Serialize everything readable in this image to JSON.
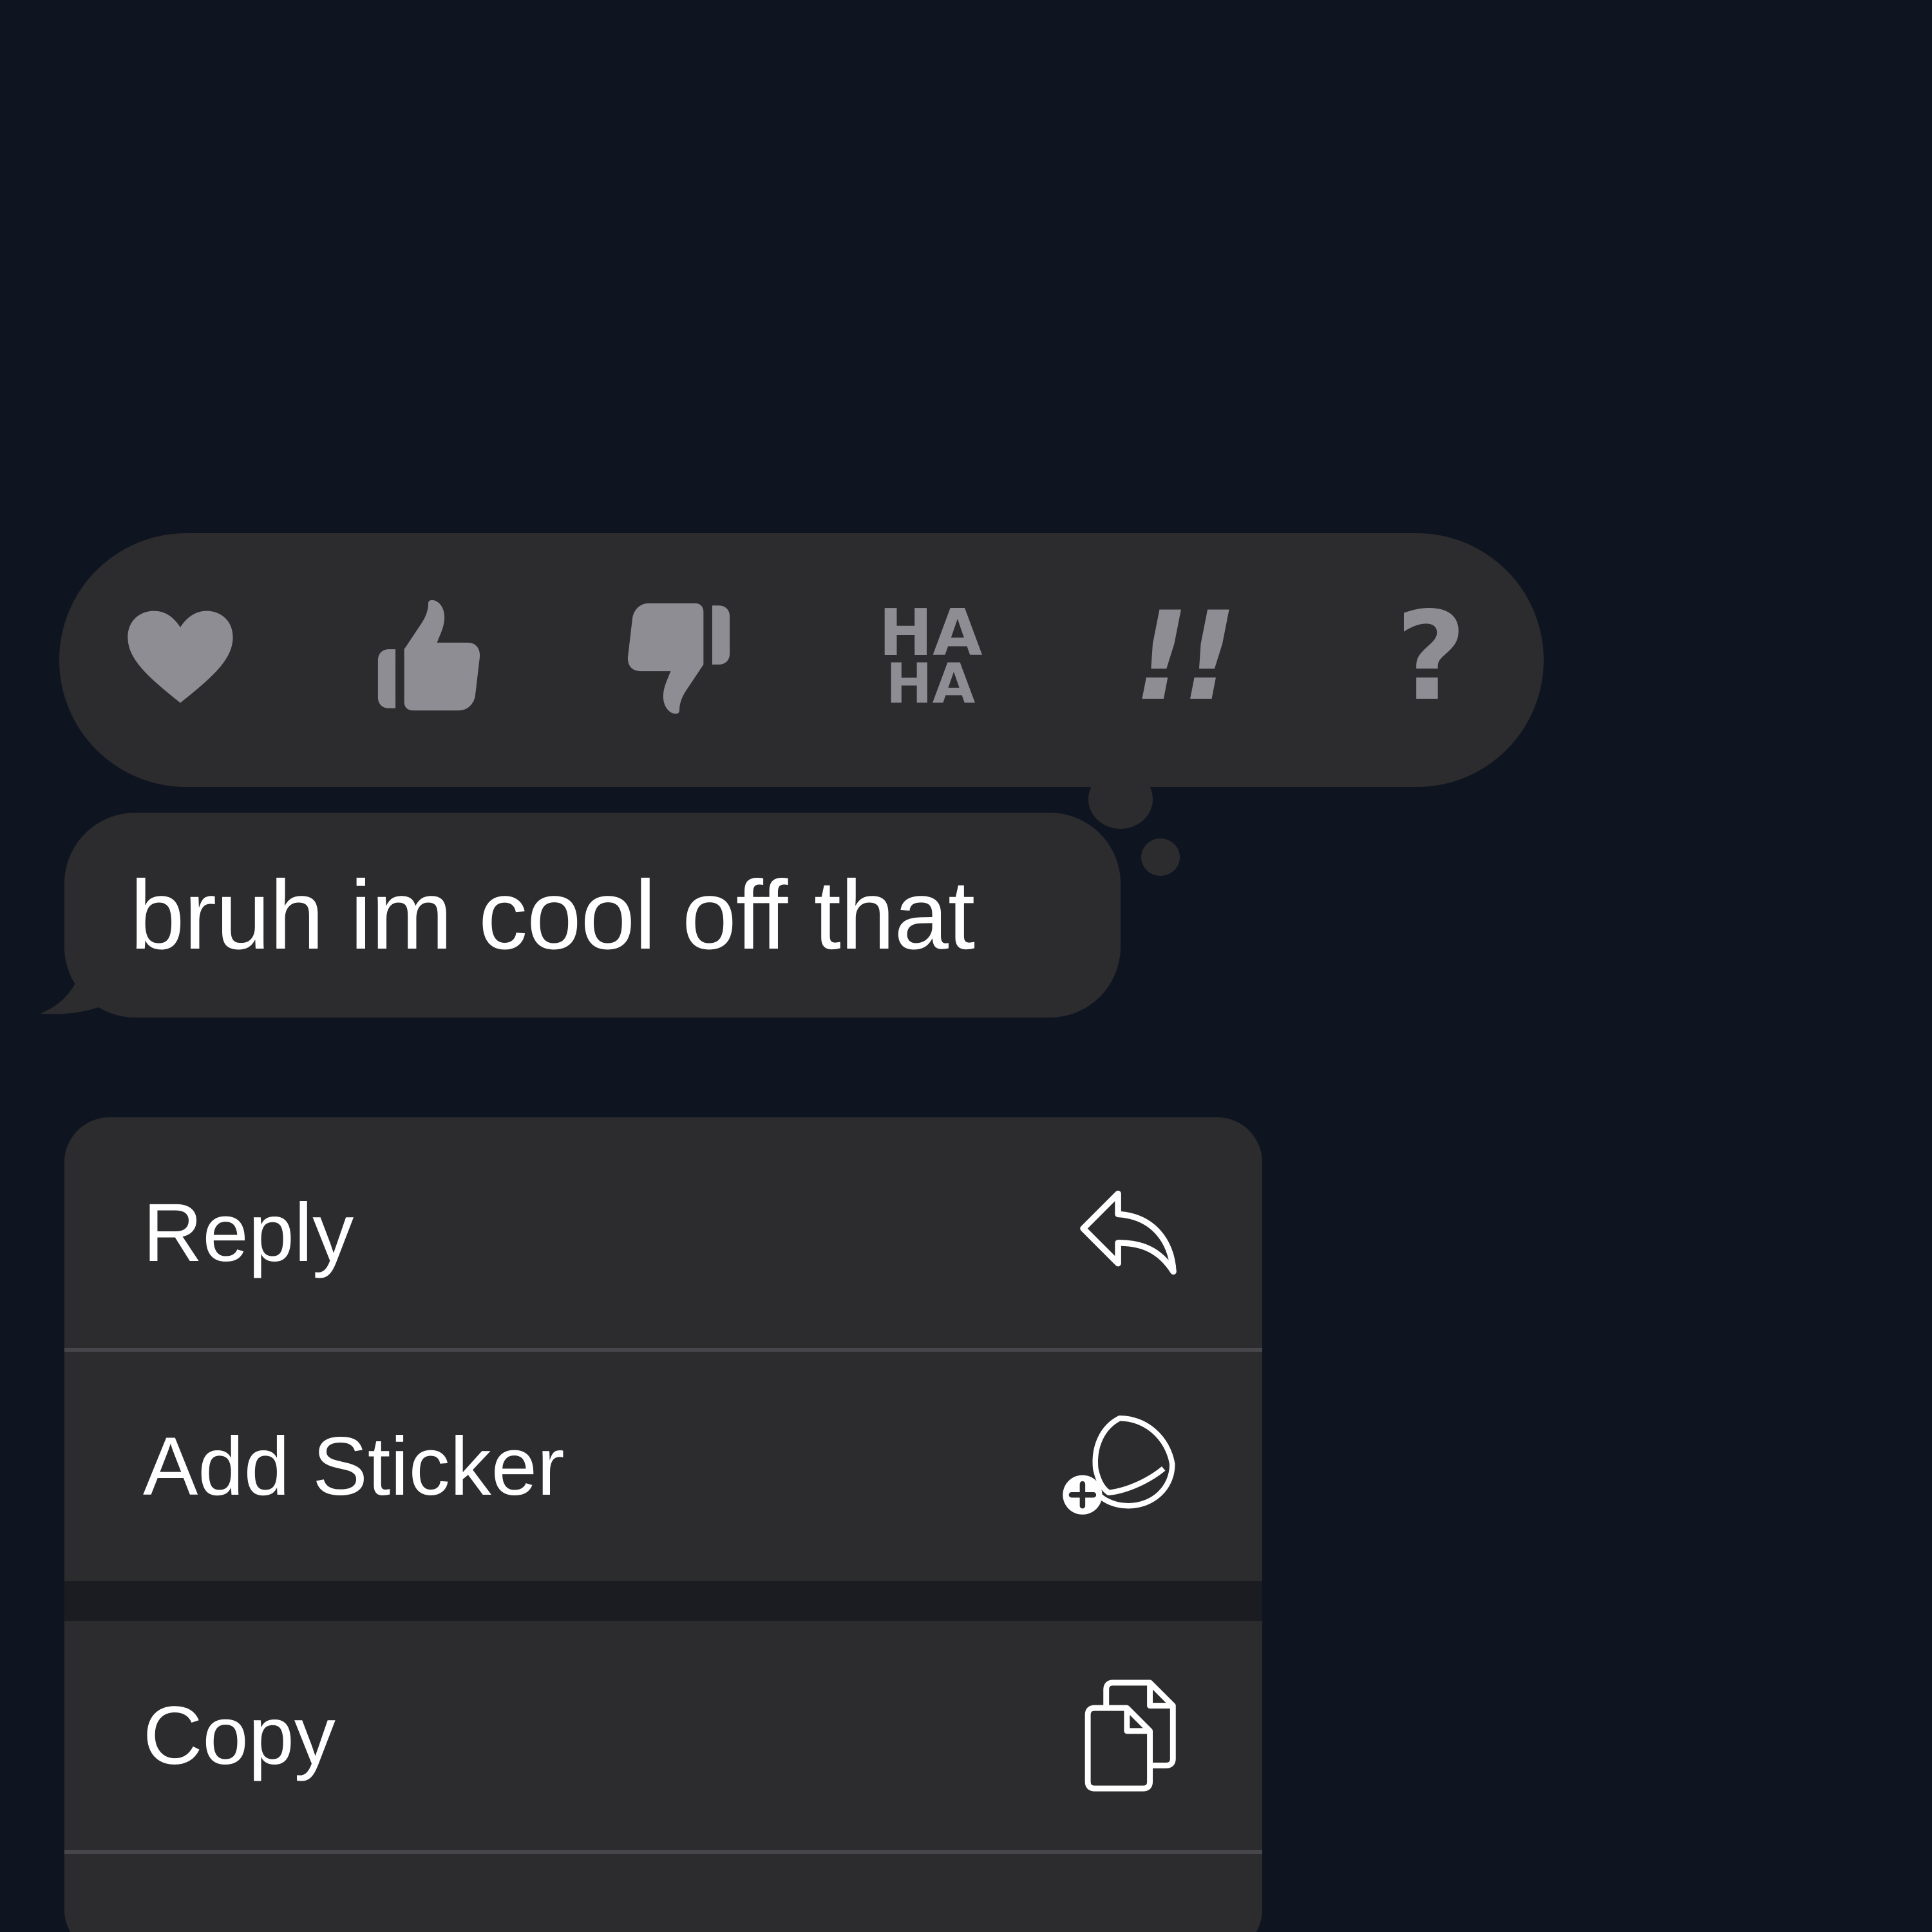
{
  "tapbacks": {
    "heart": "heart",
    "thumbs_up": "thumbs-up",
    "thumbs_down": "thumbs-down",
    "haha_line1": "HA",
    "haha_line2": "HA",
    "emphasize": "!!",
    "question": "?"
  },
  "message": {
    "text": "bruh im cool off that"
  },
  "menu": {
    "items": [
      {
        "label": "Reply",
        "icon": "reply-arrow-icon"
      },
      {
        "label": "Add Sticker",
        "icon": "sticker-add-icon"
      },
      {
        "label": "Copy",
        "icon": "copy-documents-icon"
      }
    ]
  },
  "colors": {
    "background": "#0f1520",
    "bubble": "#2c2c2e",
    "tapback_glyph": "#8d8d93",
    "text": "#ffffff"
  }
}
